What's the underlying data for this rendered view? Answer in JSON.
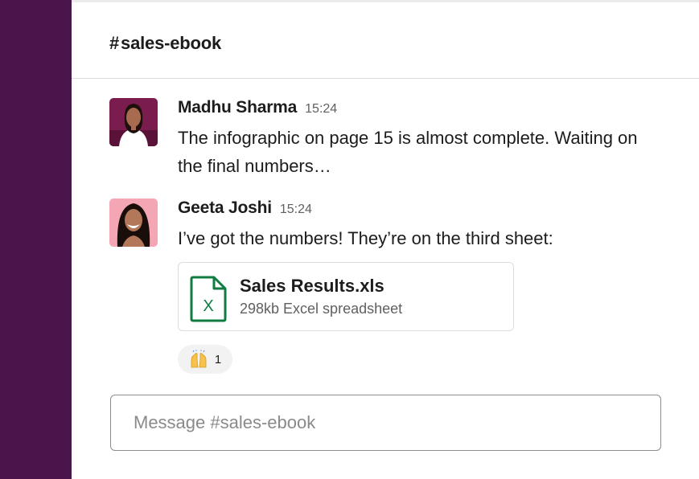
{
  "channel": {
    "hash": "#",
    "name": "sales-ebook"
  },
  "messages": [
    {
      "author": "Madhu Sharma",
      "time": "15:24",
      "text": "The infographic on page 15 is almost complete. Waiting on the final numbers…",
      "avatar_bg": "#7b1c4f"
    },
    {
      "author": "Geeta Joshi",
      "time": "15:24",
      "text": "I’ve got the numbers! They’re on the third sheet:",
      "avatar_bg": "#f4a6b4"
    }
  ],
  "attachment": {
    "name": "Sales Results.xls",
    "meta": "298kb Excel spreadsheet",
    "icon": "excel-file-icon",
    "icon_letter": "X",
    "icon_color": "#107c41"
  },
  "reaction": {
    "emoji": "raising-hands-emoji",
    "count": "1"
  },
  "composer": {
    "placeholder": "Message #sales-ebook"
  },
  "colors": {
    "sidebar": "#4a154b",
    "text": "#1d1c1d",
    "muted": "#616061",
    "border": "#dddddd"
  }
}
